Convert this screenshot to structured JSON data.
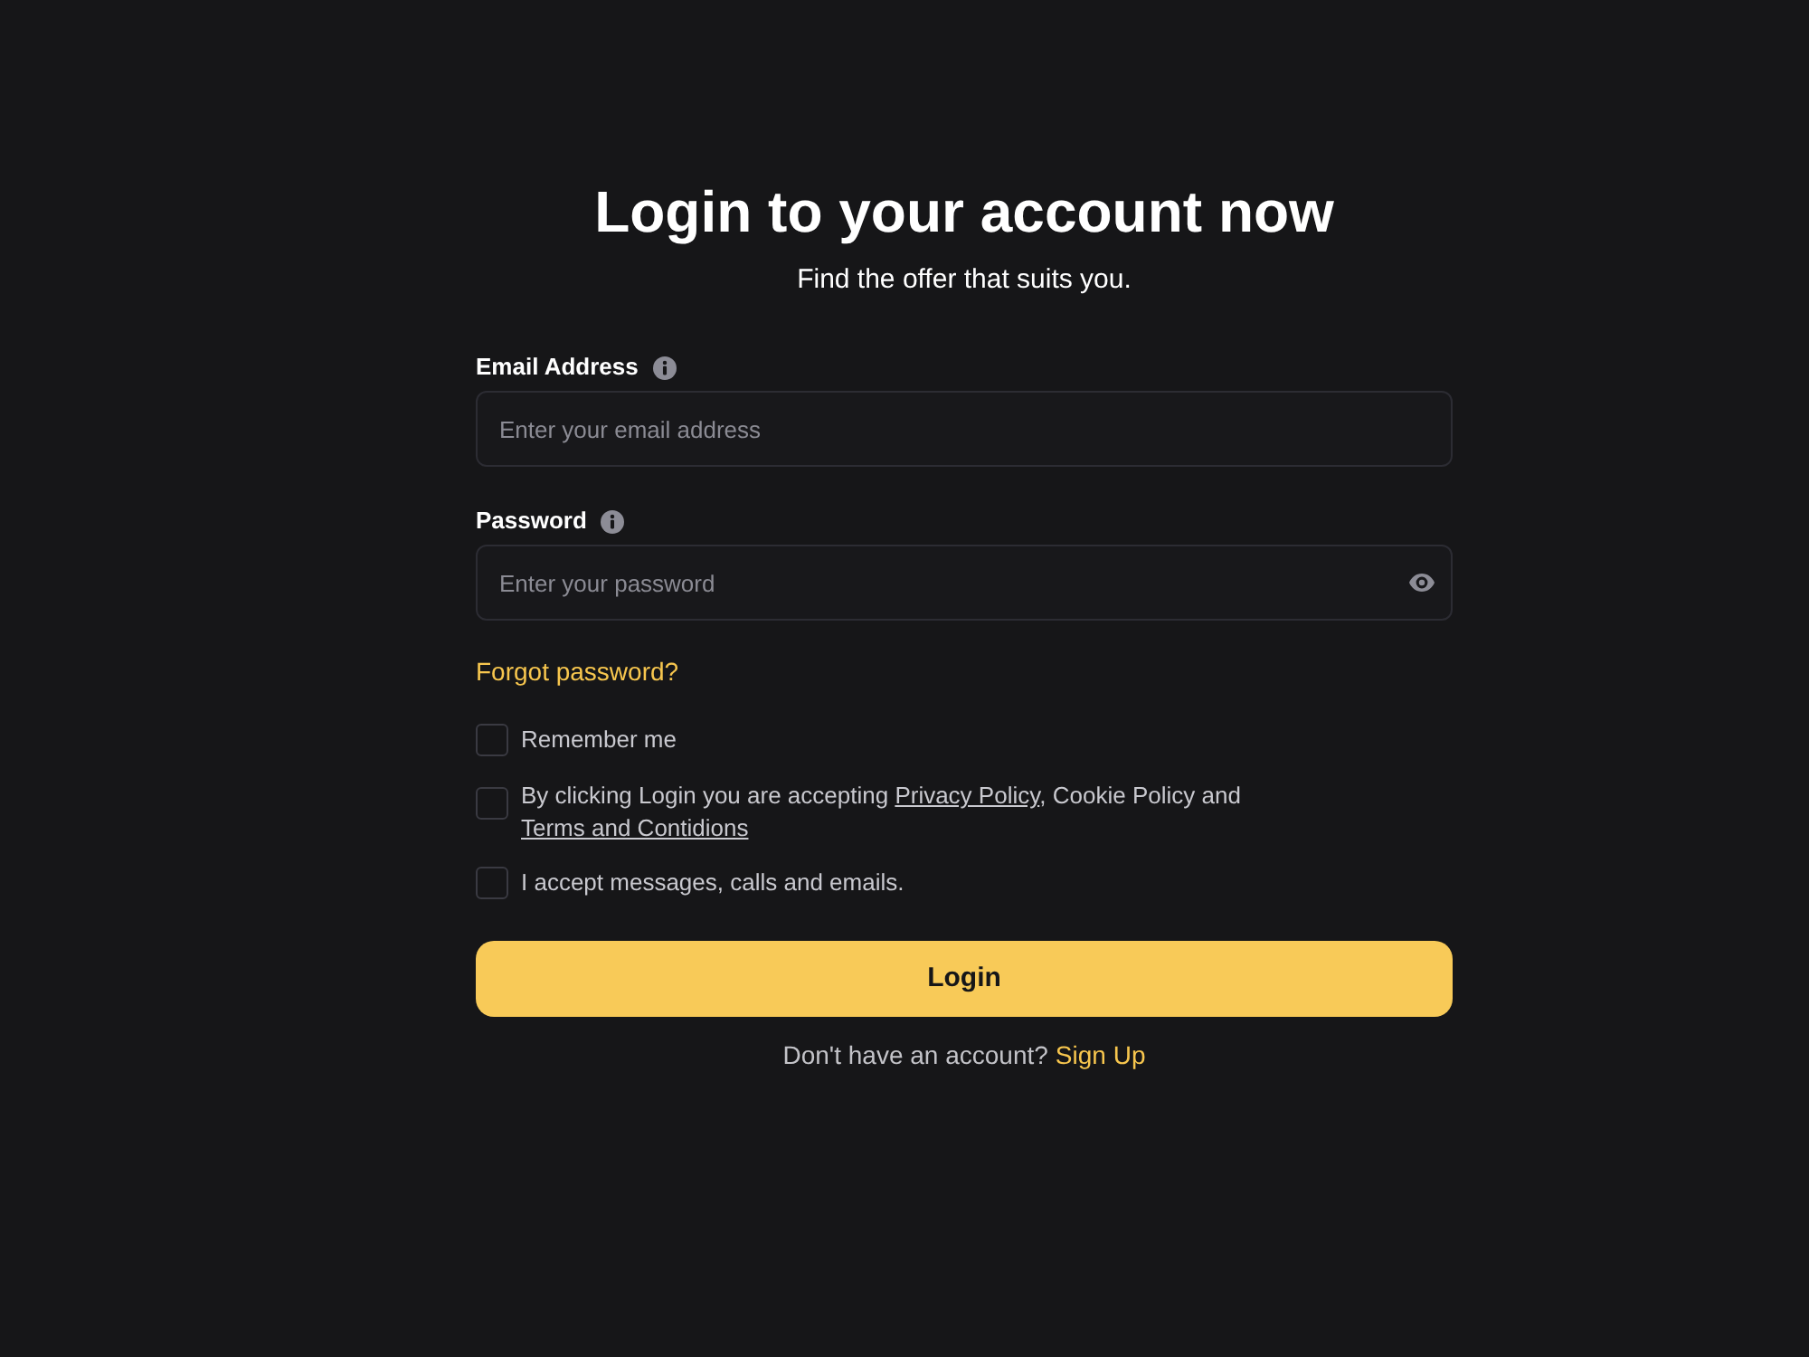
{
  "heading": {
    "title": "Login to your account now",
    "subtitle": "Find the offer that suits you."
  },
  "fields": [
    {
      "kind": "email",
      "label": "Email Address",
      "placeholder": "Enter your email address"
    },
    {
      "kind": "password",
      "label": "Password",
      "placeholder": "Enter your password"
    }
  ],
  "forgot_link": "Forgot password?",
  "checkboxes": [
    {
      "checked": false,
      "label": [
        {
          "kind": "text",
          "text": "Remember me"
        }
      ]
    },
    {
      "checked": false,
      "label": [
        {
          "kind": "text",
          "text": "By clicking Login you are accepting "
        },
        {
          "kind": "link",
          "text": "Privacy Policy"
        },
        {
          "kind": "text",
          "text": ", Cookie Policy and "
        },
        {
          "kind": "link",
          "text": "Terms and Contidions"
        }
      ]
    },
    {
      "checked": false,
      "label": [
        {
          "kind": "text",
          "text": "I accept messages, calls and emails."
        }
      ]
    }
  ],
  "login_button": "Login",
  "signup": {
    "prompt": "Don't have an account?",
    "link": "Sign Up"
  }
}
